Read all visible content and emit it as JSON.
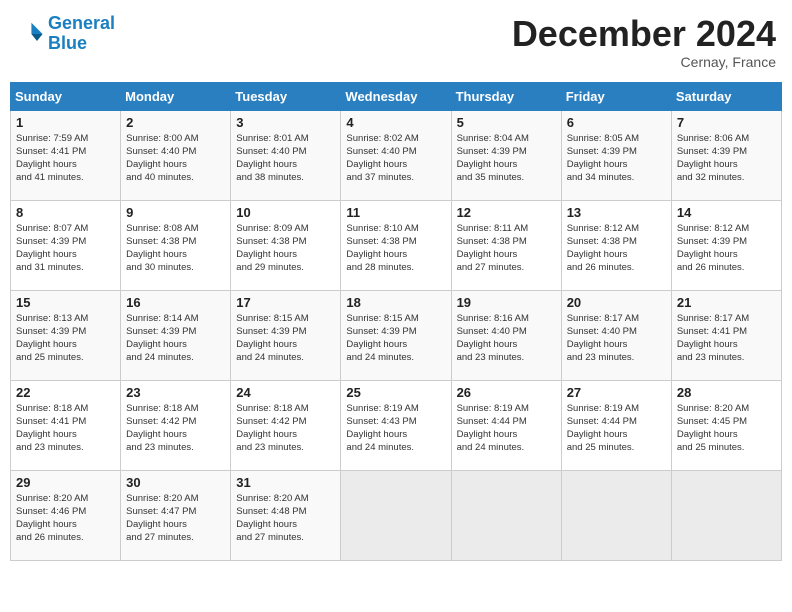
{
  "header": {
    "logo_line1": "General",
    "logo_line2": "Blue",
    "month": "December 2024",
    "location": "Cernay, France"
  },
  "weekdays": [
    "Sunday",
    "Monday",
    "Tuesday",
    "Wednesday",
    "Thursday",
    "Friday",
    "Saturday"
  ],
  "weeks": [
    [
      {
        "day": "1",
        "sunrise": "7:59 AM",
        "sunset": "4:41 PM",
        "daylight": "8 hours and 41 minutes."
      },
      {
        "day": "2",
        "sunrise": "8:00 AM",
        "sunset": "4:40 PM",
        "daylight": "8 hours and 40 minutes."
      },
      {
        "day": "3",
        "sunrise": "8:01 AM",
        "sunset": "4:40 PM",
        "daylight": "8 hours and 38 minutes."
      },
      {
        "day": "4",
        "sunrise": "8:02 AM",
        "sunset": "4:40 PM",
        "daylight": "8 hours and 37 minutes."
      },
      {
        "day": "5",
        "sunrise": "8:04 AM",
        "sunset": "4:39 PM",
        "daylight": "8 hours and 35 minutes."
      },
      {
        "day": "6",
        "sunrise": "8:05 AM",
        "sunset": "4:39 PM",
        "daylight": "8 hours and 34 minutes."
      },
      {
        "day": "7",
        "sunrise": "8:06 AM",
        "sunset": "4:39 PM",
        "daylight": "8 hours and 32 minutes."
      }
    ],
    [
      {
        "day": "8",
        "sunrise": "8:07 AM",
        "sunset": "4:39 PM",
        "daylight": "8 hours and 31 minutes."
      },
      {
        "day": "9",
        "sunrise": "8:08 AM",
        "sunset": "4:38 PM",
        "daylight": "8 hours and 30 minutes."
      },
      {
        "day": "10",
        "sunrise": "8:09 AM",
        "sunset": "4:38 PM",
        "daylight": "8 hours and 29 minutes."
      },
      {
        "day": "11",
        "sunrise": "8:10 AM",
        "sunset": "4:38 PM",
        "daylight": "8 hours and 28 minutes."
      },
      {
        "day": "12",
        "sunrise": "8:11 AM",
        "sunset": "4:38 PM",
        "daylight": "8 hours and 27 minutes."
      },
      {
        "day": "13",
        "sunrise": "8:12 AM",
        "sunset": "4:38 PM",
        "daylight": "8 hours and 26 minutes."
      },
      {
        "day": "14",
        "sunrise": "8:12 AM",
        "sunset": "4:39 PM",
        "daylight": "8 hours and 26 minutes."
      }
    ],
    [
      {
        "day": "15",
        "sunrise": "8:13 AM",
        "sunset": "4:39 PM",
        "daylight": "8 hours and 25 minutes."
      },
      {
        "day": "16",
        "sunrise": "8:14 AM",
        "sunset": "4:39 PM",
        "daylight": "8 hours and 24 minutes."
      },
      {
        "day": "17",
        "sunrise": "8:15 AM",
        "sunset": "4:39 PM",
        "daylight": "8 hours and 24 minutes."
      },
      {
        "day": "18",
        "sunrise": "8:15 AM",
        "sunset": "4:39 PM",
        "daylight": "8 hours and 24 minutes."
      },
      {
        "day": "19",
        "sunrise": "8:16 AM",
        "sunset": "4:40 PM",
        "daylight": "8 hours and 23 minutes."
      },
      {
        "day": "20",
        "sunrise": "8:17 AM",
        "sunset": "4:40 PM",
        "daylight": "8 hours and 23 minutes."
      },
      {
        "day": "21",
        "sunrise": "8:17 AM",
        "sunset": "4:41 PM",
        "daylight": "8 hours and 23 minutes."
      }
    ],
    [
      {
        "day": "22",
        "sunrise": "8:18 AM",
        "sunset": "4:41 PM",
        "daylight": "8 hours and 23 minutes."
      },
      {
        "day": "23",
        "sunrise": "8:18 AM",
        "sunset": "4:42 PM",
        "daylight": "8 hours and 23 minutes."
      },
      {
        "day": "24",
        "sunrise": "8:18 AM",
        "sunset": "4:42 PM",
        "daylight": "8 hours and 23 minutes."
      },
      {
        "day": "25",
        "sunrise": "8:19 AM",
        "sunset": "4:43 PM",
        "daylight": "8 hours and 24 minutes."
      },
      {
        "day": "26",
        "sunrise": "8:19 AM",
        "sunset": "4:44 PM",
        "daylight": "8 hours and 24 minutes."
      },
      {
        "day": "27",
        "sunrise": "8:19 AM",
        "sunset": "4:44 PM",
        "daylight": "8 hours and 25 minutes."
      },
      {
        "day": "28",
        "sunrise": "8:20 AM",
        "sunset": "4:45 PM",
        "daylight": "8 hours and 25 minutes."
      }
    ],
    [
      {
        "day": "29",
        "sunrise": "8:20 AM",
        "sunset": "4:46 PM",
        "daylight": "8 hours and 26 minutes."
      },
      {
        "day": "30",
        "sunrise": "8:20 AM",
        "sunset": "4:47 PM",
        "daylight": "8 hours and 27 minutes."
      },
      {
        "day": "31",
        "sunrise": "8:20 AM",
        "sunset": "4:48 PM",
        "daylight": "8 hours and 27 minutes."
      },
      null,
      null,
      null,
      null
    ]
  ]
}
